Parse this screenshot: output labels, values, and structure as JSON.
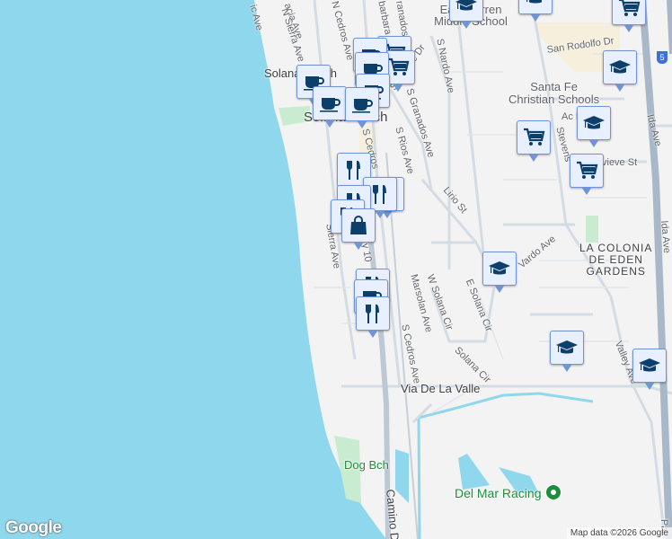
{
  "map": {
    "labels": {
      "pacific_ave": "ic Ave",
      "acacia_ave": "acia Ave",
      "n_sierra_ave": "N Sierra Ave",
      "n_cedros_ave": "N Cedros Ave",
      "barbara_ave": "barbara Ave",
      "granados_ave": "ranados Ave",
      "santa_fe_dr": "Santa Fe Dr",
      "s_nardo_ave": "S Nardo Ave",
      "s_granados_ave": "S Granados Ave",
      "s_rios_ave": "S Rios Ave",
      "s_cedros": "S Cedros",
      "san_rodolfo_dr": "San Rodolfo Dr",
      "acacia_dr": "Ac        Dr",
      "ida_ave": "Ida Ave",
      "ida_ave2": "Ida Ave",
      "stevens": "Stevens",
      "genevieve_st": "vieve St",
      "lirio_st": "Lirio St",
      "sierra_ave": "Sierra Ave",
      "hwy_101": "y 10",
      "vardo_ave": "Vardo Ave",
      "marsolan_ave": "Marsolan Ave",
      "w_solana_cir": "W Solana Cir",
      "e_solana_cir": "E Solana Cir",
      "s_cedros_ave": "S Cedros Ave",
      "solana_cir": "Solana Cir",
      "valley_ave": "Valley Ave",
      "via_de_la_valle": "Via De La Valle",
      "camino_del_mar": "Camino D",
      "del_mar_racing": "Del Mar Racing",
      "dog_beach": "Dog Bch",
      "solana_beach_top": "Solana Beach",
      "solana_beach": "Solana Beach",
      "earl_warren": "Earl Warren Middle School",
      "santa_fe_christian": "Santa Fe\nChristian Schools",
      "la_colonia": "LA COLONIA\nDE EDEN\nGARDENS",
      "i5_shield": "5",
      "pal": "Pal"
    },
    "markers": [
      {
        "type": "school-icon"
      },
      {
        "type": "school-icon"
      },
      {
        "type": "cart-icon"
      },
      {
        "type": "cart-icon"
      },
      {
        "type": "cart-icon"
      },
      {
        "type": "coffee-icon"
      },
      {
        "type": "coffee-icon"
      },
      {
        "type": "coffee-icon"
      },
      {
        "type": "coffee-icon"
      },
      {
        "type": "coffee-icon"
      },
      {
        "type": "coffee-icon"
      },
      {
        "type": "school-icon"
      },
      {
        "type": "cart-icon"
      },
      {
        "type": "school-icon"
      },
      {
        "type": "cart-icon"
      },
      {
        "type": "food-icon"
      },
      {
        "type": "bag-icon"
      },
      {
        "type": "food-icon"
      },
      {
        "type": "food-icon"
      },
      {
        "type": "food-icon"
      },
      {
        "type": "bag-icon"
      },
      {
        "type": "school-icon"
      },
      {
        "type": "food-icon"
      },
      {
        "type": "coffee-icon"
      },
      {
        "type": "food-icon"
      },
      {
        "type": "school-icon"
      },
      {
        "type": "school-icon"
      }
    ],
    "attribution": "Map data ©2026 Google",
    "logo": "Google",
    "colors": {
      "water": "#8fd7ed",
      "land": "#f4f3f4",
      "park": "#c9ecd0",
      "road": "#d3dbe3",
      "highway": "#a9b8c8",
      "marker_bg": "#e8efff",
      "marker_border": "#6f95d8",
      "marker_icon": "#0d3f6b"
    }
  }
}
